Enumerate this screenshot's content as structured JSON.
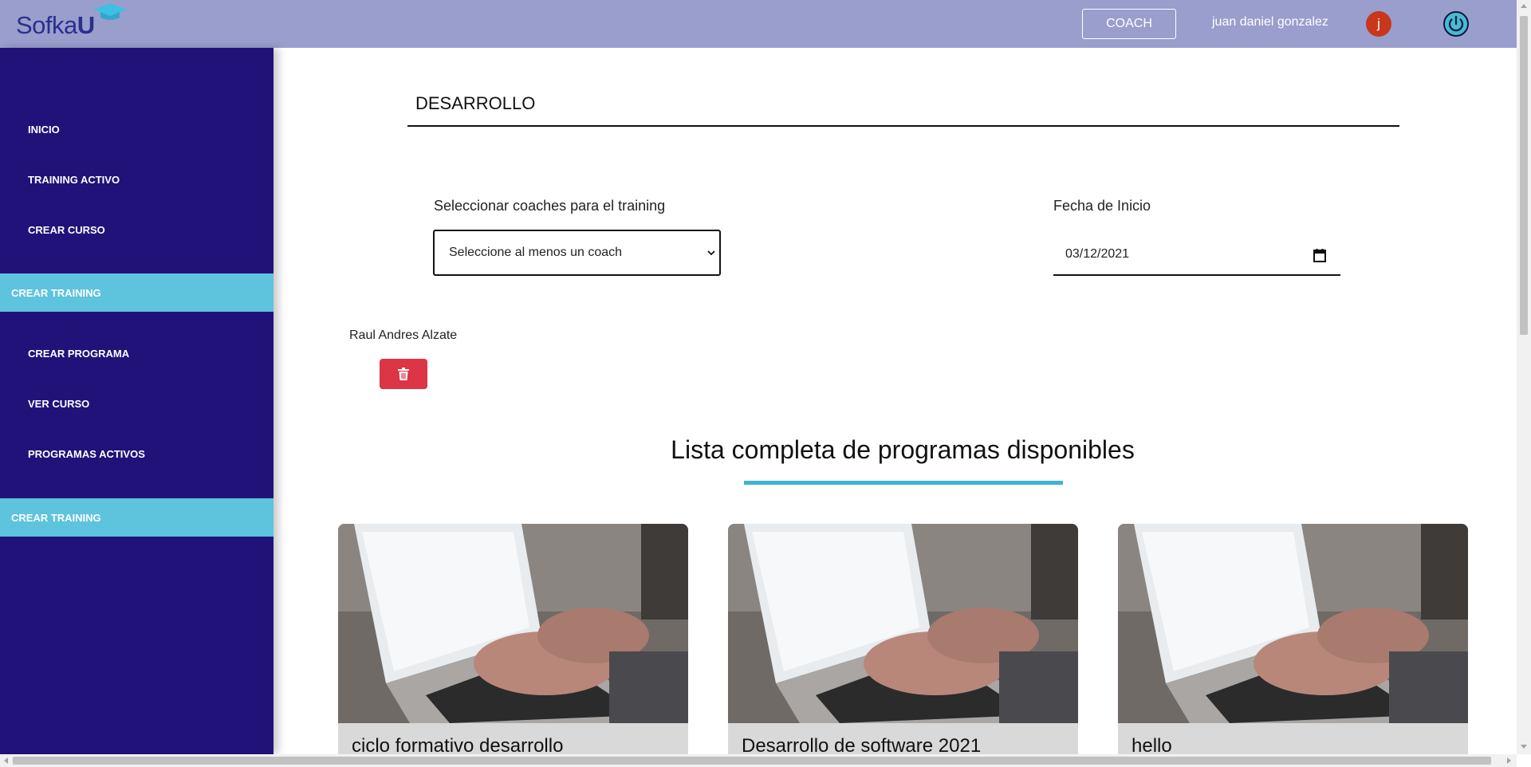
{
  "header": {
    "logo_text": "Sofka",
    "logo_u": "U",
    "role_button": "COACH",
    "username": "juan daniel gonzalez",
    "avatar_letter": "j"
  },
  "sidebar": {
    "items": [
      {
        "label": "INICIO"
      },
      {
        "label": "TRAINING ACTIVO"
      },
      {
        "label": "CREAR CURSO"
      },
      {
        "label": "CREAR TRAINING"
      },
      {
        "label": "CREAR PROGRAMA"
      },
      {
        "label": "VER CURSO"
      },
      {
        "label": "PROGRAMAS ACTIVOS"
      },
      {
        "label": "CREAR TRAINING"
      }
    ],
    "highlight_color": "#5ec3dc",
    "background_color": "#21127a"
  },
  "main": {
    "title": "DESARROLLO",
    "coaches_label": "Seleccionar coaches para el training",
    "coaches_select_value": "Seleccione al menos un coach",
    "date_label": "Fecha de Inicio",
    "date_value": "03/12/2021",
    "selected_coach": "Raul Andres Alzate",
    "list_heading": "Lista completa de programas disponibles",
    "programs": [
      {
        "title": "ciclo formativo desarrollo"
      },
      {
        "title": "Desarrollo de software 2021"
      },
      {
        "title": "hello"
      }
    ]
  },
  "colors": {
    "header_bg": "#9a9ecc",
    "delete_red": "#dc3545",
    "accent_cyan": "#3db4d3"
  }
}
